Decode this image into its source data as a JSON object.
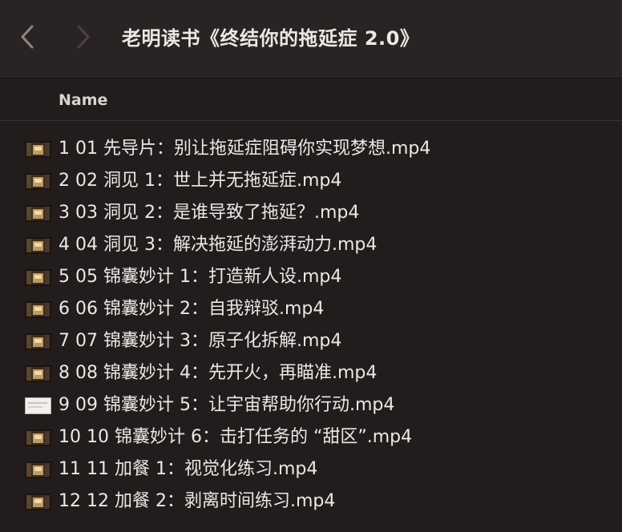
{
  "window": {
    "title": "老明读书《终结你的拖延症 2.0》"
  },
  "toolbar": {
    "back_icon": "chevron-left-icon",
    "forward_icon": "chevron-right-icon"
  },
  "list": {
    "column_header": "Name",
    "files": [
      {
        "name": "1 01 先导片：别让拖延症阻碍你实现梦想.mp4",
        "thumb": "video-thumb-dark"
      },
      {
        "name": "2 02 洞见 1：世上并无拖延症.mp4",
        "thumb": "video-thumb-dark"
      },
      {
        "name": "3 03 洞见 2：是谁导致了拖延？.mp4",
        "thumb": "video-thumb-dark"
      },
      {
        "name": "4 04 洞见 3：解决拖延的澎湃动力.mp4",
        "thumb": "video-thumb-dark"
      },
      {
        "name": "5 05 锦囊妙计 1：打造新人设.mp4",
        "thumb": "video-thumb-dark"
      },
      {
        "name": "6 06 锦囊妙计 2：自我辩驳.mp4",
        "thumb": "video-thumb-dark"
      },
      {
        "name": "7 07 锦囊妙计 3：原子化拆解.mp4",
        "thumb": "video-thumb-dark"
      },
      {
        "name": "8 08 锦囊妙计 4：先开火，再瞄准.mp4",
        "thumb": "video-thumb-dark"
      },
      {
        "name": "9 09 锦囊妙计 5：让宇宙帮助你行动.mp4",
        "thumb": "video-thumb-light"
      },
      {
        "name": "10 10 锦囊妙计 6：击打任务的 “甜区”.mp4",
        "thumb": "video-thumb-dark"
      },
      {
        "name": "11 11 加餐 1：视觉化练习.mp4",
        "thumb": "video-thumb-dark"
      },
      {
        "name": "12 12 加餐 2：剥离时间练习.mp4",
        "thumb": "video-thumb-dark"
      }
    ]
  },
  "colors": {
    "background": "#231c1d",
    "toolbar": "#2a2324",
    "text": "#ece8e6"
  }
}
